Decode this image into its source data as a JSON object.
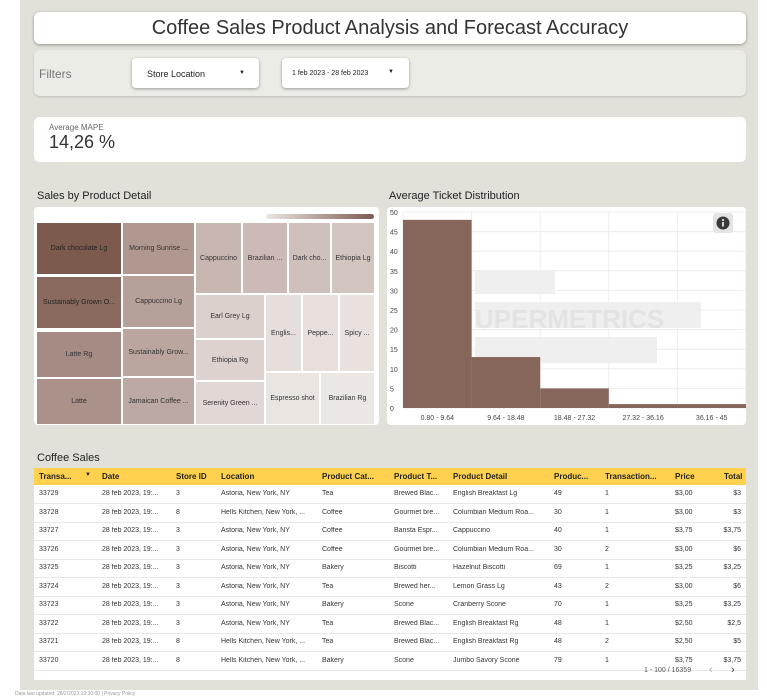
{
  "title": "Coffee Sales  Product Analysis and Forecast Accuracy",
  "filters": {
    "label": "Filters",
    "store_location": "Store Location",
    "date_range": "1 feb 2023 - 28 feb 2023"
  },
  "mape": {
    "label": "Average MAPE",
    "value": "14,26 %"
  },
  "treemap": {
    "title": "Sales by Product Detail",
    "items": [
      {
        "label": "Dark chocolate Lg",
        "color": "#7d5a4e",
        "text_color": "#222"
      },
      {
        "label": "Sustainably Grown O...",
        "color": "#8a6a5e",
        "text_color": "#222"
      },
      {
        "label": "Latte Rg",
        "color": "#a58b83",
        "text_color": "#333"
      },
      {
        "label": "Latte",
        "color": "#aa918a",
        "text_color": "#333"
      },
      {
        "label": "Morning Sunrise ...",
        "color": "#b09890",
        "text_color": "#333"
      },
      {
        "label": "Cappuccino Lg",
        "color": "#b6a09a",
        "text_color": "#333"
      },
      {
        "label": "Sustainably Grow...",
        "color": "#bba69f",
        "text_color": "#333"
      },
      {
        "label": "Jamaican Coffee ...",
        "color": "#bda9a3",
        "text_color": "#333"
      },
      {
        "label": "Cappuccino",
        "color": "#c8b7b1",
        "text_color": "#333"
      },
      {
        "label": "Brazilian ...",
        "color": "#cbbab5",
        "text_color": "#333"
      },
      {
        "label": "Dark cho...",
        "color": "#cfc0bb",
        "text_color": "#333"
      },
      {
        "label": "Ethiopia Lg",
        "color": "#d2c4bf",
        "text_color": "#333"
      },
      {
        "label": "Earl Grey Lg",
        "color": "#dcd0cc",
        "text_color": "#333"
      },
      {
        "label": "Ethiopia Rg",
        "color": "#ddd2ce",
        "text_color": "#333"
      },
      {
        "label": "Serenity Green ...",
        "color": "#e1d7d4",
        "text_color": "#333"
      },
      {
        "label": "Englis...",
        "color": "#e6dedb",
        "text_color": "#333"
      },
      {
        "label": "Peppe...",
        "color": "#e7dfdc",
        "text_color": "#333"
      },
      {
        "label": "Spicy ...",
        "color": "#e8e1de",
        "text_color": "#333"
      },
      {
        "label": "Espresso shot",
        "color": "#ebe5e2",
        "text_color": "#333"
      },
      {
        "label": "Brazilian Rg",
        "color": "#ece6e4",
        "text_color": "#333"
      }
    ]
  },
  "chart_data": {
    "type": "bar",
    "title": "Average Ticket Distribution",
    "categories": [
      "0.80 - 9.64",
      "9.64 - 18.48",
      "18.48 - 27.32",
      "27.32 - 36.16",
      "36.16 - 45"
    ],
    "values": [
      48,
      13,
      5,
      1,
      1
    ],
    "ylim": [
      0,
      50
    ],
    "yticks": [
      "0",
      "5",
      "10",
      "15",
      "20",
      "25",
      "30",
      "35",
      "40",
      "45",
      "50"
    ],
    "bar_color": "#86665a",
    "grid": true,
    "info_icon": "info-icon",
    "watermark": "UPERMETRICS"
  },
  "table": {
    "title": "Coffee Sales",
    "headers": [
      "Transa...",
      "Date",
      "Store ID",
      "Location",
      "Product Cat...",
      "Product T...",
      "Product Detail",
      "Produc...",
      "Transaction...",
      "Price",
      "Total"
    ],
    "sort_icon": "sort-down-icon",
    "rows": [
      [
        "33729",
        "28 feb 2023, 19:...",
        "3",
        "Astoria, New York, NY",
        "Tea",
        "Brewed Blac...",
        "English Breakfast Lg",
        "49",
        "1",
        "$3,00",
        "$3"
      ],
      [
        "33728",
        "28 feb 2023, 19:...",
        "8",
        "Hells Kitchen, New York, ...",
        "Coffee",
        "Gourmet bre...",
        "Columbian Medium Roa...",
        "30",
        "1",
        "$3,00",
        "$3"
      ],
      [
        "33727",
        "28 feb 2023, 19:...",
        "3",
        "Astoria, New York, NY",
        "Coffee",
        "Barista Espr...",
        "Cappuccino",
        "40",
        "1",
        "$3,75",
        "$3,75"
      ],
      [
        "33726",
        "28 feb 2023, 19:...",
        "3",
        "Astoria, New York, NY",
        "Coffee",
        "Gourmet bre...",
        "Columbian Medium Roa...",
        "30",
        "2",
        "$3,00",
        "$6"
      ],
      [
        "33725",
        "28 feb 2023, 19:...",
        "3",
        "Astoria, New York, NY",
        "Bakery",
        "Biscotti",
        "Hazelnut Biscotti",
        "69",
        "1",
        "$3,25",
        "$3,25"
      ],
      [
        "33724",
        "28 feb 2023, 19:...",
        "3",
        "Astoria, New York, NY",
        "Tea",
        "Brewed her...",
        "Lemon Grass Lg",
        "43",
        "2",
        "$3,00",
        "$6"
      ],
      [
        "33723",
        "28 feb 2023, 19:...",
        "3",
        "Astoria, New York, NY",
        "Bakery",
        "Scone",
        "Cranberry Scone",
        "70",
        "1",
        "$3,25",
        "$3,25"
      ],
      [
        "33722",
        "28 feb 2023, 19:...",
        "3",
        "Astoria, New York, NY",
        "Tea",
        "Brewed Blac...",
        "English Breakfast Rg",
        "48",
        "1",
        "$2,50",
        "$2,5"
      ],
      [
        "33721",
        "28 feb 2023, 19:...",
        "8",
        "Hells Kitchen, New York, ...",
        "Tea",
        "Brewed Blac...",
        "English Breakfast Rg",
        "48",
        "2",
        "$2,50",
        "$5"
      ],
      [
        "33720",
        "28 feb 2023, 19:...",
        "8",
        "Hells Kitchen, New York, ...",
        "Bakery",
        "Scone",
        "Jumbo Savory Scone",
        "79",
        "1",
        "$3,75",
        "$3,75"
      ]
    ],
    "pagination": "1 - 100 / 16359",
    "prev_icon": "chevron-left-icon",
    "next_icon": "chevron-right-icon"
  },
  "footer": "Data last updated: 28/2/2023 19:30:00 | Privacy Policy"
}
